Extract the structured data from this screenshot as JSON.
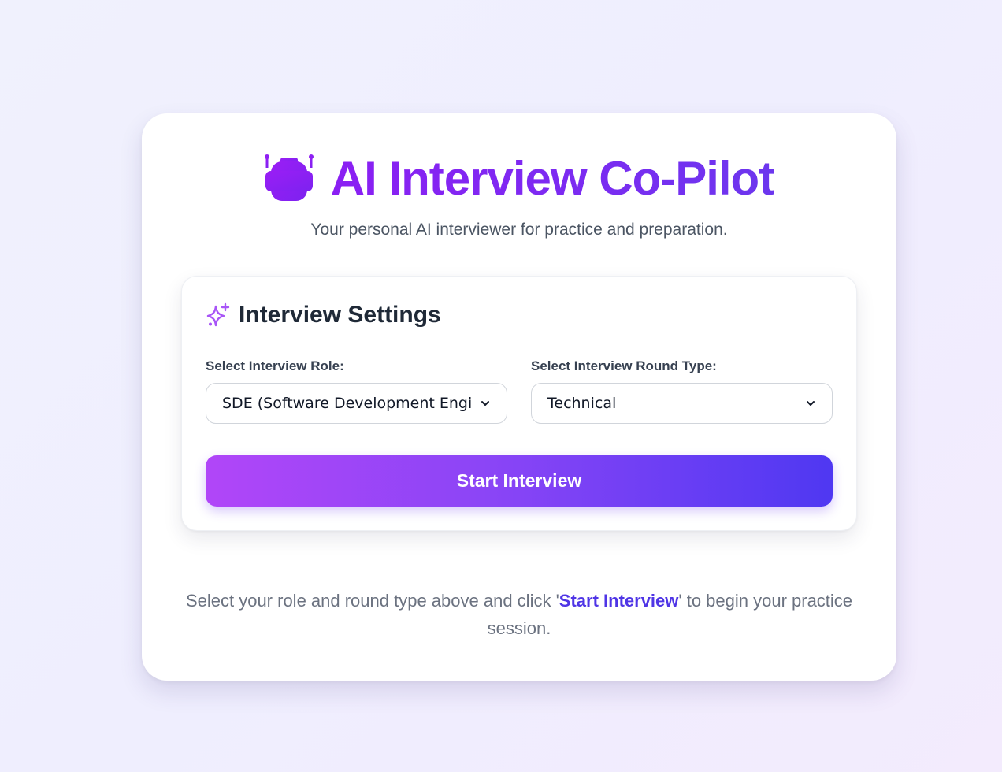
{
  "header": {
    "title": "AI Interview Co-Pilot",
    "subtitle": "Your personal AI interviewer for practice and preparation.",
    "icon": "robot-icon"
  },
  "settings": {
    "title": "Interview Settings",
    "icon": "sparkle-icon",
    "role": {
      "label": "Select Interview Role:",
      "value": "SDE (Software Development Engineer)"
    },
    "round": {
      "label": "Select Interview Round Type:",
      "value": "Technical"
    },
    "start_button": "Start Interview"
  },
  "hint": {
    "before": "Select your role and round type above and click '",
    "link": "Start Interview",
    "after": "' to begin your practice session."
  },
  "colors": {
    "accent": "#8b1ff3",
    "button_start": "#b146f8",
    "button_end": "#4f38f2",
    "link": "#4f35e6"
  }
}
